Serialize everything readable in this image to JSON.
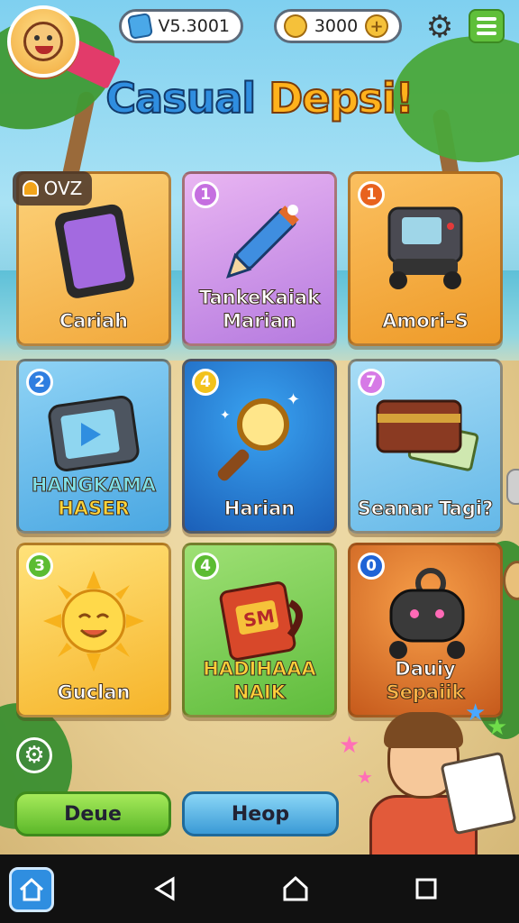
{
  "header": {
    "version_text": "V5.3001",
    "coins_text": "3000",
    "logo_icon": "game-logo-icon",
    "settings_icon": "gear-icon",
    "menu_icon": "hamburger-menu-icon"
  },
  "title": {
    "part1": "Casual ",
    "part2": "Depsi!"
  },
  "badge": {
    "label": "OVZ",
    "icon": "bell-icon"
  },
  "tiles": [
    {
      "label": "Cariah",
      "sub": "",
      "number": "",
      "icon": "tablet-icon"
    },
    {
      "label": "TankeKaiak",
      "sub": "Marian",
      "number": "1",
      "icon": "pencil-icon"
    },
    {
      "label": "Amori–S",
      "sub": "",
      "number": "1",
      "icon": "robot-icon"
    },
    {
      "label": "HANGKAMA",
      "sub": "HASER",
      "number": "2",
      "icon": "video-player-icon"
    },
    {
      "label": "Harian",
      "sub": "",
      "number": "4",
      "icon": "magnifier-icon"
    },
    {
      "label": "Seanar Tagi?",
      "sub": "",
      "number": "7",
      "icon": "wallet-icon"
    },
    {
      "label": "Guclan",
      "sub": "",
      "number": "3",
      "icon": "sun-icon"
    },
    {
      "label": "HADIHAAA",
      "sub": "NAIK",
      "number": "4",
      "icon": "mug-icon"
    },
    {
      "label": "Dauiy",
      "sub": "Sepaiik",
      "number": "0",
      "icon": "camera-robot-icon"
    }
  ],
  "tile_mug_text": "SM",
  "buttons": {
    "deue": "Deue",
    "heop": "Heop"
  },
  "navbar": {
    "home_app_icon": "home-app-icon",
    "back_icon": "back-icon",
    "home_icon": "home-icon",
    "recents_icon": "recents-icon"
  },
  "colors": {
    "title_blue": "#2f8ee0",
    "title_orange": "#ffb21c",
    "button_green": "#5cb82a",
    "button_blue": "#3a9ad6"
  }
}
